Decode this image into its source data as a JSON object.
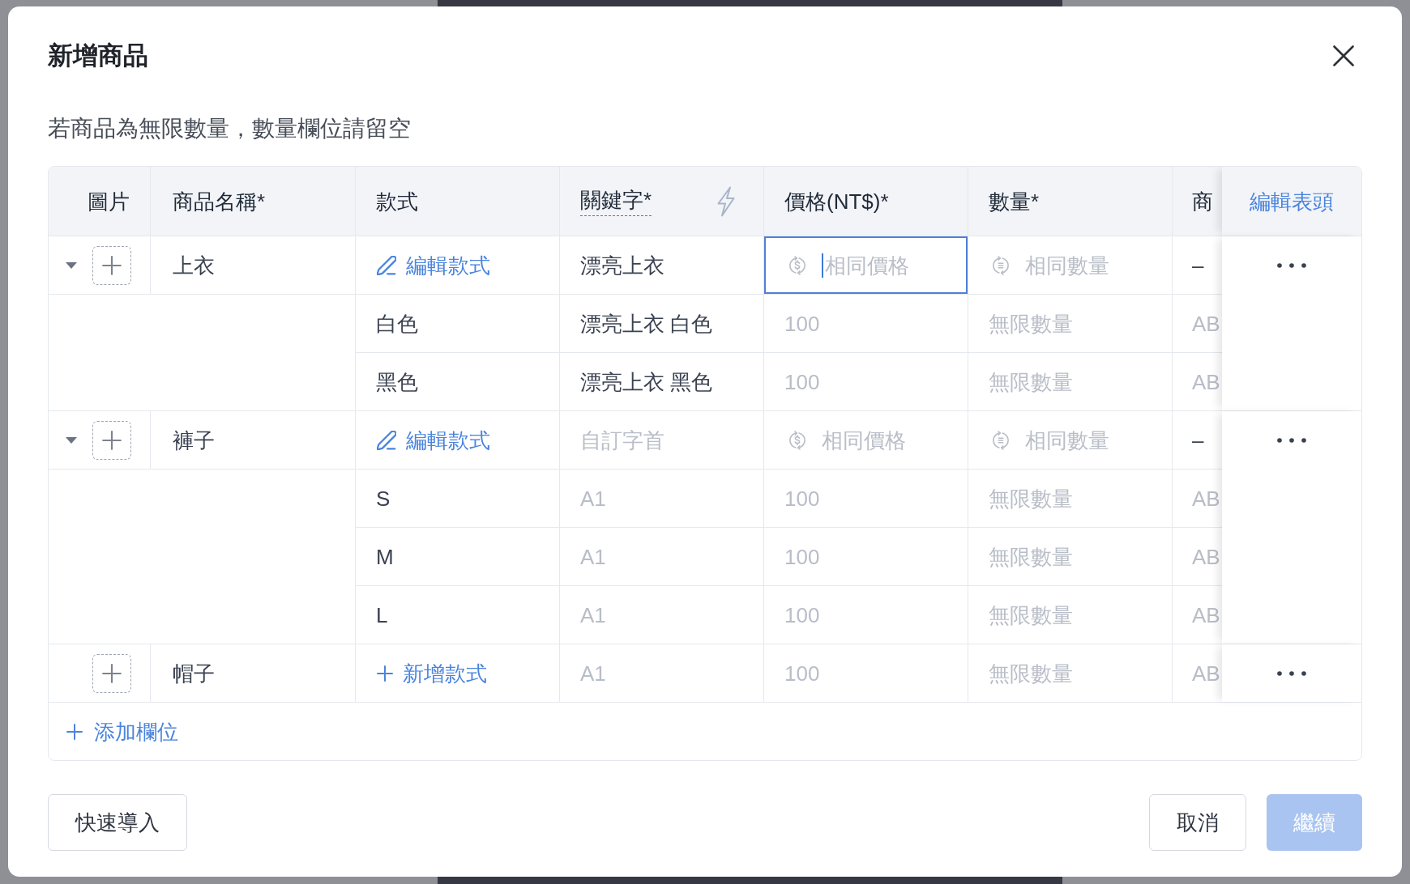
{
  "dialog": {
    "title": "新增商品",
    "hint": "若商品為無限數量，數量欄位請留空",
    "table": {
      "columns": [
        {
          "label": "圖片",
          "kind": "plain"
        },
        {
          "label": "商品名稱*",
          "kind": "plain"
        },
        {
          "label": "款式",
          "kind": "plain"
        },
        {
          "label": "關鍵字*",
          "kind": "generator"
        },
        {
          "label": "價格(NT$)*",
          "kind": "plain"
        },
        {
          "label": "數量*",
          "kind": "plain"
        },
        {
          "label": "商",
          "kind": "plain"
        }
      ],
      "edit_header": "編輯表頭",
      "products": [
        {
          "name": "上衣",
          "expanded": true,
          "style_action": {
            "kind": "edit",
            "label": "編輯款式"
          },
          "keyword": {
            "value": "漂亮上衣"
          },
          "price": {
            "kind": "sync",
            "placeholder": "相同價格",
            "focused": true
          },
          "quantity": {
            "kind": "sync",
            "placeholder": "相同數量"
          },
          "column_7": {
            "value": "–"
          },
          "variants": [
            {
              "name": "白色",
              "keyword": {
                "value": "漂亮上衣 白色"
              },
              "price": {
                "placeholder": "100"
              },
              "quantity": {
                "placeholder": "無限數量"
              },
              "column_7": {
                "placeholder": "AB"
              }
            },
            {
              "name": "黑色",
              "keyword": {
                "value": "漂亮上衣 黑色"
              },
              "price": {
                "placeholder": "100"
              },
              "quantity": {
                "placeholder": "無限數量"
              },
              "column_7": {
                "placeholder": "AB"
              }
            }
          ]
        },
        {
          "name": "褲子",
          "expanded": true,
          "style_action": {
            "kind": "edit",
            "label": "編輯款式"
          },
          "keyword": {
            "placeholder": "自訂字首"
          },
          "price": {
            "kind": "sync",
            "placeholder": "相同價格"
          },
          "quantity": {
            "kind": "sync",
            "placeholder": "相同數量"
          },
          "column_7": {
            "value": "–"
          },
          "variants": [
            {
              "name": "S",
              "keyword": {
                "placeholder": "A1"
              },
              "price": {
                "placeholder": "100"
              },
              "quantity": {
                "placeholder": "無限數量"
              },
              "column_7": {
                "placeholder": "AB"
              }
            },
            {
              "name": "M",
              "keyword": {
                "placeholder": "A1"
              },
              "price": {
                "placeholder": "100"
              },
              "quantity": {
                "placeholder": "無限數量"
              },
              "column_7": {
                "placeholder": "AB"
              }
            },
            {
              "name": "L",
              "keyword": {
                "placeholder": "A1"
              },
              "price": {
                "placeholder": "100"
              },
              "quantity": {
                "placeholder": "無限數量"
              },
              "column_7": {
                "placeholder": "AB"
              }
            }
          ]
        },
        {
          "name": "帽子",
          "style_action": {
            "kind": "add",
            "label": "新增款式"
          },
          "keyword": {
            "placeholder": "A1"
          },
          "price": {
            "placeholder": "100"
          },
          "quantity": {
            "placeholder": "無限數量"
          },
          "column_7": {
            "placeholder": "AB"
          }
        }
      ]
    },
    "add_field": "添加欄位",
    "footer": {
      "left_buttons": [
        {
          "label": "快速導入",
          "kind": "secondary",
          "disabled": false
        }
      ],
      "right_buttons": [
        {
          "label": "取消",
          "kind": "secondary",
          "disabled": false
        },
        {
          "label": "繼續",
          "kind": "primary",
          "disabled": true
        }
      ]
    }
  }
}
